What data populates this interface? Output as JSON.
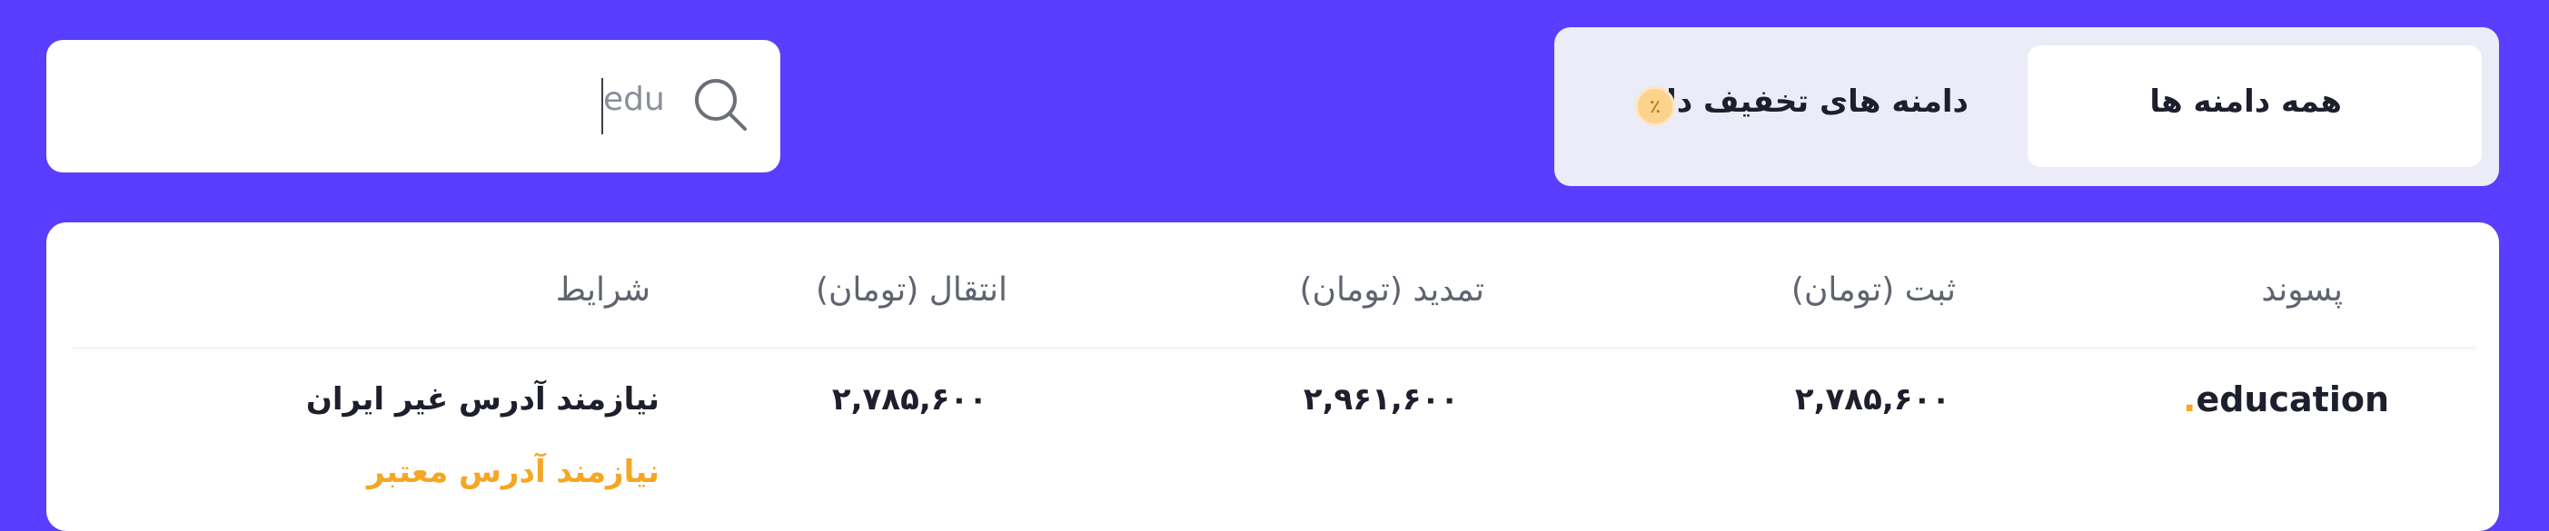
{
  "search": {
    "value": "edu",
    "icon": "search-icon"
  },
  "tabs": [
    {
      "label": "همه دامنه ها",
      "active": true
    },
    {
      "label": "دامنه های تخفیف دار",
      "active": false,
      "icon": "percent-badge-icon",
      "icon_glyph": "٪"
    }
  ],
  "table": {
    "headers": {
      "suffix": "پسوند",
      "register": "ثبت (تومان)",
      "renew": "تمدید (تومان)",
      "transfer": "انتقال (تومان)",
      "conditions": "شرایط"
    },
    "rows": [
      {
        "suffix_dot": ".",
        "suffix_name": "education",
        "register": "۲,۷۸۵,۶۰۰",
        "renew": "۲,۹۶۱,۶۰۰",
        "transfer": "۲,۷۸۵,۶۰۰",
        "condition_1": "نیازمند آدرس غیر ایران",
        "condition_2": "نیازمند آدرس معتبر"
      }
    ]
  },
  "colors": {
    "background": "#5a3eff",
    "accent": "#f5a623",
    "text": "#1d1f2c"
  }
}
